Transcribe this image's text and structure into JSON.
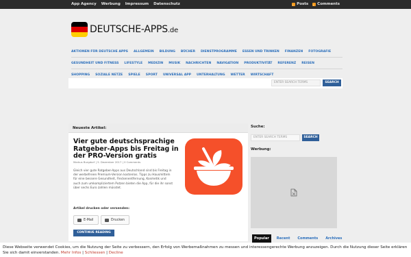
{
  "topbar": {
    "links": [
      "App Agency",
      "Werbung",
      "Impressum",
      "Datenschutz"
    ],
    "feeds": [
      {
        "icon": "rss-icon",
        "label": "Posts"
      },
      {
        "icon": "rss-icon",
        "label": "Comments"
      }
    ]
  },
  "header": {
    "logo_text": "DEUTSCHE-APPS",
    "logo_tld": ".de",
    "flag_colors": [
      "#000000",
      "#dd0000",
      "#ffce00"
    ]
  },
  "categories": {
    "row1": [
      "AKTIONEN FÜR DEUTSCHE APPS",
      "ALLGEMEIN",
      "BILDUNG",
      "BÜCHER",
      "DIENSTPROGRAMME",
      "ESSEN UND TRINKEN",
      "FINANZEN",
      "FOTOGRAFIE"
    ],
    "row2": [
      "GESUNDHEIT UND FITNESS",
      "LIFESTYLE",
      "MEDIZIN",
      "MUSIK",
      "NACHRICHTEN",
      "NAVIGATION",
      "PRODUKTIVITÄT",
      "REFERENZ",
      "REISEN"
    ],
    "row3": [
      "SHOPPING",
      "SOZIALE NETZE",
      "SPIELE",
      "SPORT",
      "UNIVERSAL APP",
      "UNTERHALTUNG",
      "WETTER",
      "WIRTSCHAFT"
    ]
  },
  "top_search": {
    "placeholder": "ENTER SEARCH TERMS",
    "button": "SEARCH"
  },
  "main": {
    "section_title": "Neueste Artikel:",
    "article": {
      "title": "Vier gute deutschsprachige Ratgeber-Apps bis Freitag in der PRO-Version gratis",
      "meta": "Markus Burgdorf | 5. Dezember 2017 | 0 Comments",
      "excerpt": "Gleich vier gute Ratgeber-Apps aus Deutschland sind bis Freitag in der werbefreien Premium-Version kostenlos. Tipps zu Hausmitteln für eine bessere Gesundheit, Fleckenentfernung, Kosmetik und auch zum umkompliziertem Putzen bieten die App, für die ihr sonst über sechs Euro zahlen müsstet.",
      "share_label": "Artikel drucken oder versenden:",
      "share_mail": "E-Mail",
      "share_print": "Drucken",
      "read_more": "CONTINUE READING",
      "image_color": "#f5502a"
    }
  },
  "sidebar": {
    "search_label": "Suche:",
    "search_placeholder": "ENTER SEARCH TERMS",
    "search_button": "SEARCH",
    "ad_label": "Werbung:",
    "tabs": [
      "Popular",
      "Recent",
      "Comments",
      "Archives"
    ]
  },
  "cookie": {
    "text": "Diese Webseite verwendet Cookies, um die Nutzung der Seite zu verbessern, den Erfolg von Werbemaßnahmen zu messen und interessengerechte Werbung anzuzeigen. Durch die Nutzung dieser Seite erklären Sie sich damit einverstanden.",
    "more": "Mehr Infos",
    "close": "Schliessen",
    "decline": "Decline",
    "separator": " | "
  }
}
